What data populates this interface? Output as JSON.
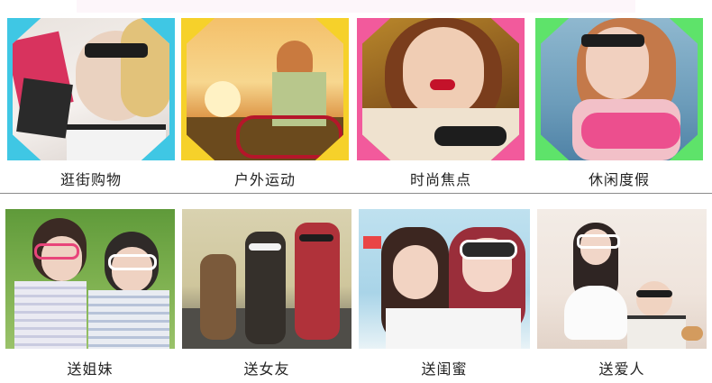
{
  "row1": [
    {
      "label": "逛街购物",
      "accent": "#4fd0e8"
    },
    {
      "label": "户外运动",
      "accent": "#f7d22e"
    },
    {
      "label": "时尚焦点",
      "accent": "#f25a9c"
    },
    {
      "label": "休闲度假",
      "accent": "#5ee36a"
    }
  ],
  "row2": [
    {
      "label": "送姐妹"
    },
    {
      "label": "送女友"
    },
    {
      "label": "送闺蜜"
    },
    {
      "label": "送爱人"
    }
  ]
}
